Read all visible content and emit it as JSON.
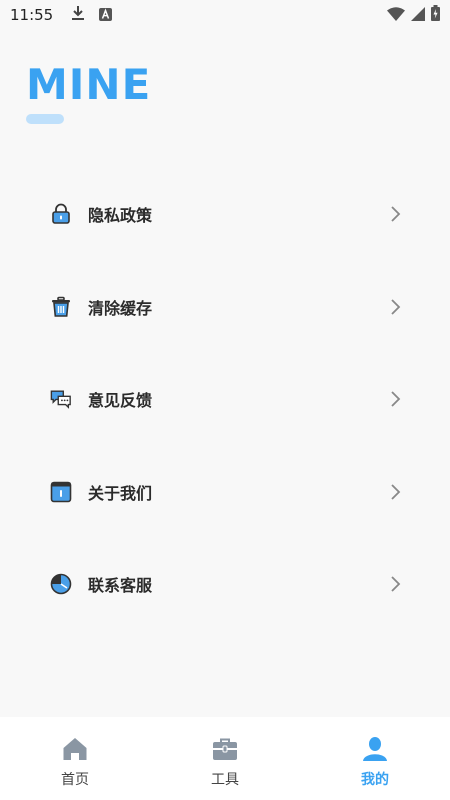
{
  "status_bar": {
    "time": "11:55",
    "left_icons": [
      "download-icon",
      "a-badge-icon"
    ],
    "right_icons": [
      "wifi-icon",
      "signal-icon",
      "battery-icon"
    ]
  },
  "page": {
    "title": "MINE",
    "accent_color": "#3aa2f1"
  },
  "menu": {
    "items": [
      {
        "label": "隐私政策",
        "icon": "lock-icon"
      },
      {
        "label": "清除缓存",
        "icon": "trash-icon"
      },
      {
        "label": "意见反馈",
        "icon": "chat-bubbles-icon"
      },
      {
        "label": "关于我们",
        "icon": "info-card-icon"
      },
      {
        "label": "联系客服",
        "icon": "service-globe-icon"
      }
    ]
  },
  "tab_bar": {
    "tabs": [
      {
        "label": "首页",
        "icon": "home-icon",
        "active": false
      },
      {
        "label": "工具",
        "icon": "toolbox-icon",
        "active": false
      },
      {
        "label": "我的",
        "icon": "user-icon",
        "active": true
      }
    ]
  }
}
